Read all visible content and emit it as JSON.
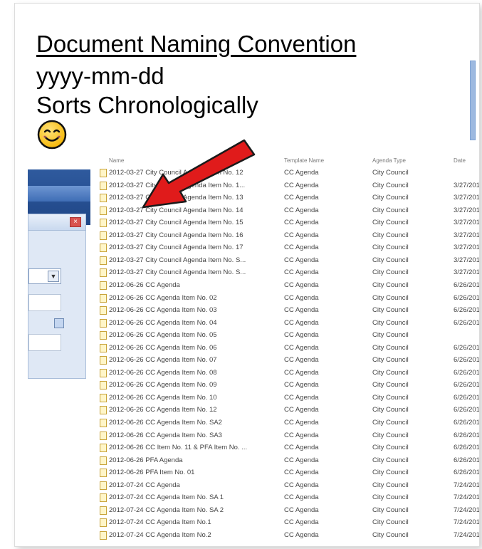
{
  "slide": {
    "title": "Document Naming Convention",
    "format": "yyyy-mm-dd",
    "caption": "Sorts Chronologically",
    "emoji": "smiling-face-icon"
  },
  "explorer": {
    "columns": [
      "Name",
      "Template Name",
      "Agenda Type",
      "Date"
    ],
    "rows": [
      {
        "name": "2012-03-27 City Council Agenda Item No. 12",
        "template": "CC Agenda",
        "type": "City Council",
        "date": ""
      },
      {
        "name": "2012-03-27 City Council Agenda Item No. 1...",
        "template": "CC Agenda",
        "type": "City Council",
        "date": "3/27/201."
      },
      {
        "name": "2012-03-27 City Council Agenda Item No. 13",
        "template": "CC Agenda",
        "type": "City Council",
        "date": "3/27/201."
      },
      {
        "name": "2012-03-27 City Council Agenda Item No. 14",
        "template": "CC Agenda",
        "type": "City Council",
        "date": "3/27/201."
      },
      {
        "name": "2012-03-27 City Council Agenda Item No. 15",
        "template": "CC Agenda",
        "type": "City Council",
        "date": "3/27/201."
      },
      {
        "name": "2012-03-27 City Council Agenda Item No. 16",
        "template": "CC Agenda",
        "type": "City Council",
        "date": "3/27/201."
      },
      {
        "name": "2012-03-27 City Council Agenda Item No. 17",
        "template": "CC Agenda",
        "type": "City Council",
        "date": "3/27/201."
      },
      {
        "name": "2012-03-27 City Council Agenda Item No. S...",
        "template": "CC Agenda",
        "type": "City Council",
        "date": "3/27/201."
      },
      {
        "name": "2012-03-27 City Council Agenda Item No. S...",
        "template": "CC Agenda",
        "type": "City Council",
        "date": "3/27/201."
      },
      {
        "name": "2012-06-26 CC Agenda",
        "template": "CC Agenda",
        "type": "City Council",
        "date": "6/26/201."
      },
      {
        "name": "2012-06-26 CC Agenda Item No. 02",
        "template": "CC Agenda",
        "type": "City Council",
        "date": "6/26/201."
      },
      {
        "name": "2012-06-26 CC Agenda Item No. 03",
        "template": "CC Agenda",
        "type": "City Council",
        "date": "6/26/201."
      },
      {
        "name": "2012-06-26 CC Agenda Item No. 04",
        "template": "CC Agenda",
        "type": "City Council",
        "date": "6/26/201."
      },
      {
        "name": "2012-06-26 CC Agenda Item No. 05",
        "template": "CC Agenda",
        "type": "City Council",
        "date": ""
      },
      {
        "name": "2012-06-26 CC Agenda Item No. 06",
        "template": "CC Agenda",
        "type": "City Council",
        "date": "6/26/201."
      },
      {
        "name": "2012-06-26 CC Agenda Item No. 07",
        "template": "CC Agenda",
        "type": "City Council",
        "date": "6/26/201."
      },
      {
        "name": "2012-06-26 CC Agenda Item No. 08",
        "template": "CC Agenda",
        "type": "City Council",
        "date": "6/26/201."
      },
      {
        "name": "2012-06-26 CC Agenda Item No. 09",
        "template": "CC Agenda",
        "type": "City Council",
        "date": "6/26/201."
      },
      {
        "name": "2012-06-26 CC Agenda Item No. 10",
        "template": "CC Agenda",
        "type": "City Council",
        "date": "6/26/201."
      },
      {
        "name": "2012-06-26 CC Agenda Item No. 12",
        "template": "CC Agenda",
        "type": "City Council",
        "date": "6/26/201."
      },
      {
        "name": "2012-06-26 CC Agenda Item No. SA2",
        "template": "CC Agenda",
        "type": "City Council",
        "date": "6/26/201."
      },
      {
        "name": "2012-06-26 CC Agenda Item No. SA3",
        "template": "CC Agenda",
        "type": "City Council",
        "date": "6/26/201."
      },
      {
        "name": "2012-06-26 CC Item No. 11 & PFA Item No. ...",
        "template": "CC Agenda",
        "type": "City Council",
        "date": "6/26/201."
      },
      {
        "name": "2012-06-26 PFA Agenda",
        "template": "CC Agenda",
        "type": "City Council",
        "date": "6/26/201."
      },
      {
        "name": "2012-06-26 PFA Item No. 01",
        "template": "CC Agenda",
        "type": "City Council",
        "date": "6/26/201."
      },
      {
        "name": "2012-07-24 CC Agenda",
        "template": "CC Agenda",
        "type": "City Council",
        "date": "7/24/201."
      },
      {
        "name": "2012-07-24 CC Agenda Item No. SA 1",
        "template": "CC Agenda",
        "type": "City Council",
        "date": "7/24/201."
      },
      {
        "name": "2012-07-24 CC Agenda Item No. SA 2",
        "template": "CC Agenda",
        "type": "City Council",
        "date": "7/24/201."
      },
      {
        "name": "2012-07-24 CC Agenda Item No.1",
        "template": "CC Agenda",
        "type": "City Council",
        "date": "7/24/201."
      },
      {
        "name": "2012-07-24 CC Agenda Item No.2",
        "template": "CC Agenda",
        "type": "City Council",
        "date": "7/24/201."
      }
    ]
  },
  "colors": {
    "arrow": "#e01b1b",
    "arrow_outline": "#1a1a1a",
    "left_pane_dark": "#1f4686",
    "file_icon": "#fff6c9"
  }
}
